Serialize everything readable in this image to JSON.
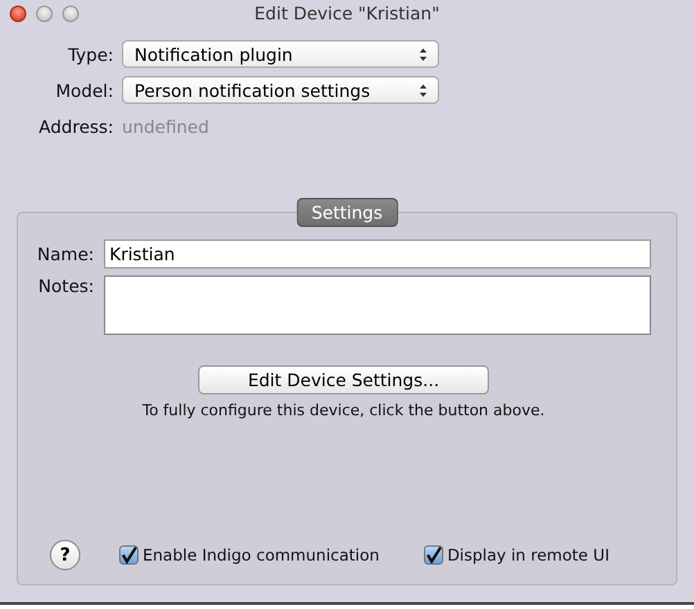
{
  "window": {
    "title": "Edit Device \"Kristian\""
  },
  "fields": [
    {
      "label": "Type:",
      "value": "Notification plugin",
      "kind": "popup"
    },
    {
      "label": "Model:",
      "value": "Person notification settings",
      "kind": "popup"
    },
    {
      "label": "Address:",
      "value": "undefined",
      "kind": "static"
    }
  ],
  "settings": {
    "tab": "Settings",
    "name_label": "Name:",
    "name_value": "Kristian",
    "notes_label": "Notes:",
    "button": "Edit Device Settings...",
    "hint": "To fully configure this device, click the button above."
  },
  "footer": {
    "help": "?",
    "checkboxes": [
      {
        "label": "Enable Indigo communication",
        "checked": true
      },
      {
        "label": "Display in remote UI",
        "checked": true
      }
    ]
  }
}
